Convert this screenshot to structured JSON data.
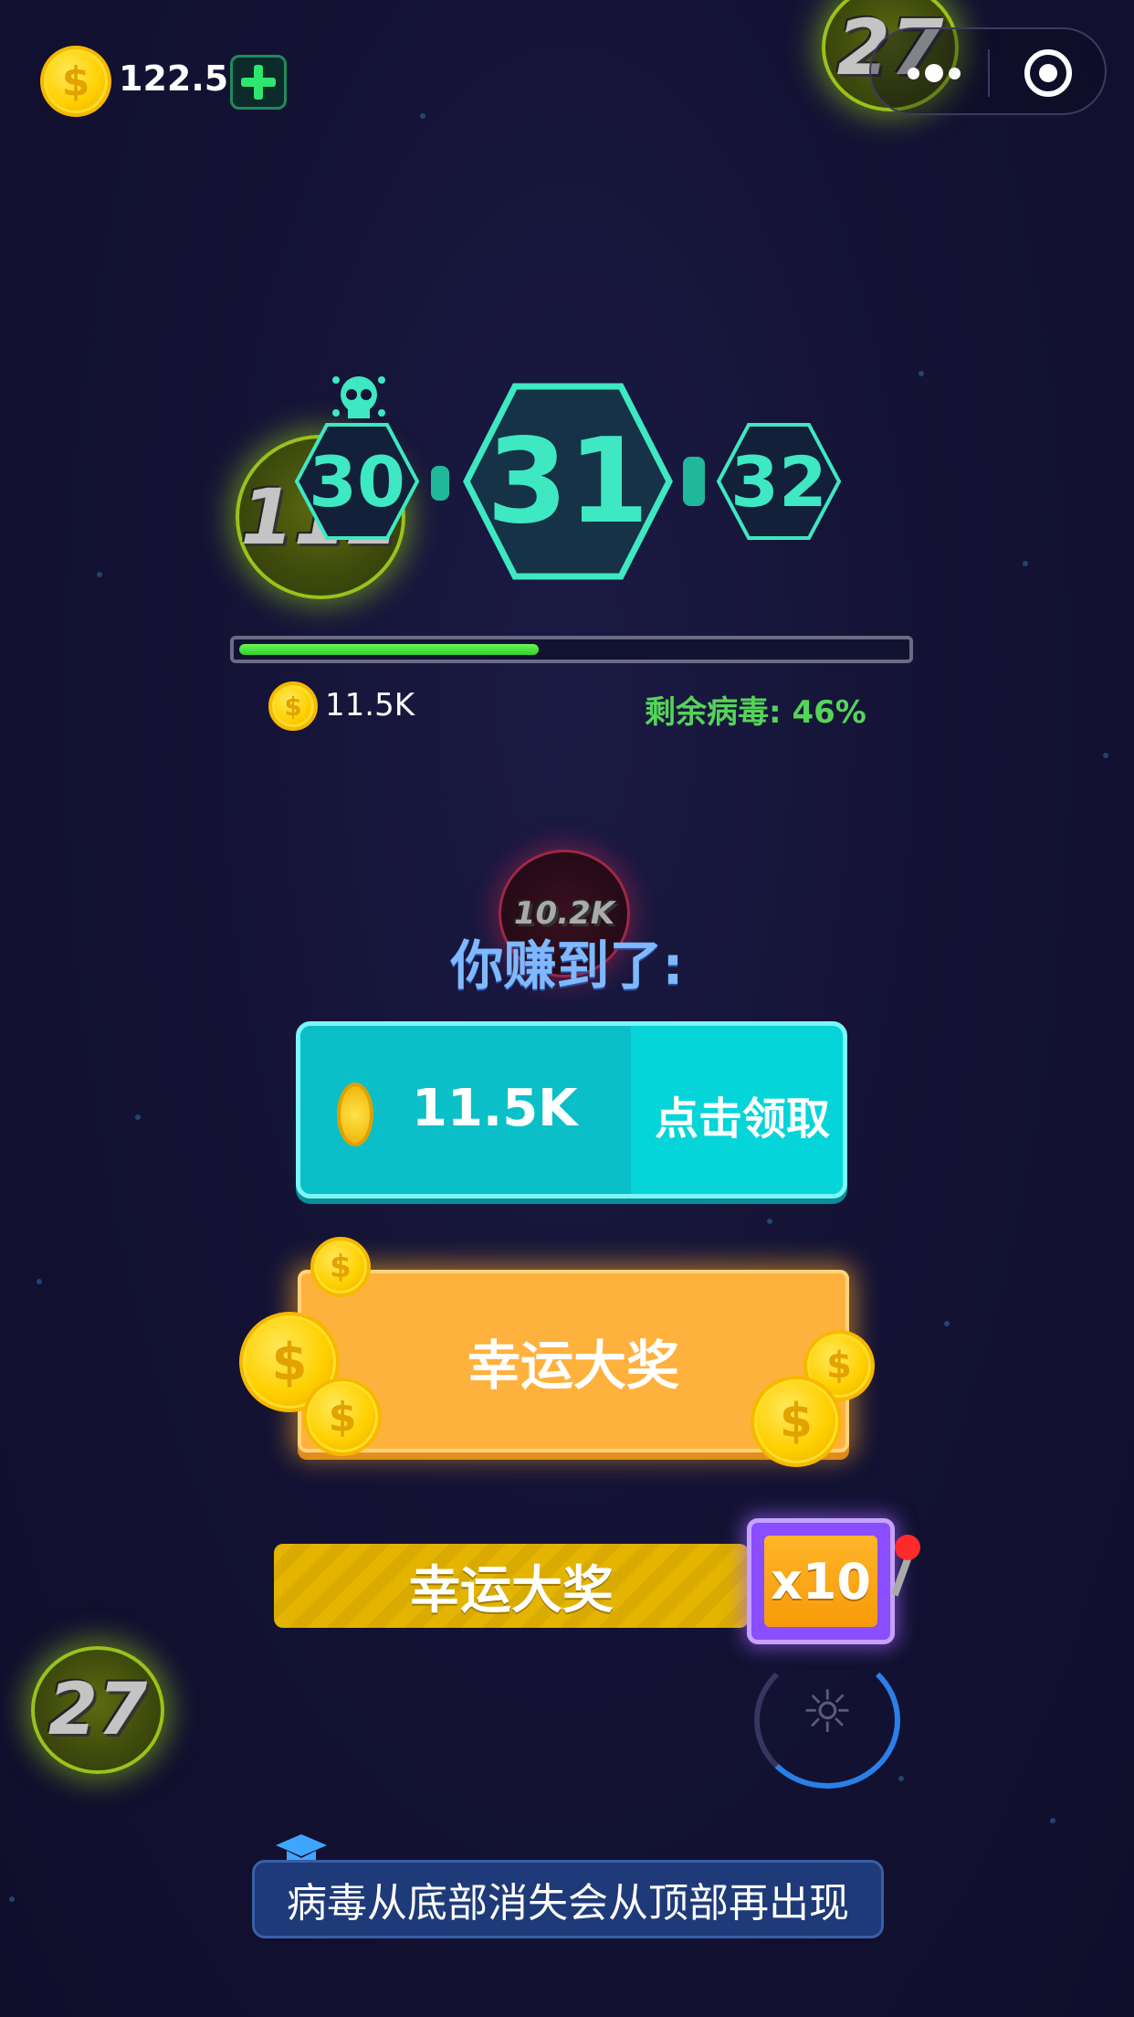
{
  "top_bar": {
    "coin_balance": "122.5K",
    "coin_symbol": "$"
  },
  "level": {
    "previous": "30",
    "current": "31",
    "next": "32"
  },
  "progress": {
    "fraction": 0.45
  },
  "stats": {
    "earned": "11.5K",
    "remaining_label": "剩余病毒",
    "remaining_value": "46%"
  },
  "background_viruses": [
    {
      "label": "27"
    },
    {
      "label": "112"
    },
    {
      "label": "27"
    },
    {
      "label": "10.2K"
    }
  ],
  "reward": {
    "title": "你赚到了:",
    "amount": "11.5K",
    "claim_label": "点击领取"
  },
  "lucky_button": {
    "label": "幸运大奖"
  },
  "lucky_bar": {
    "label": "幸运大奖",
    "multiplier": "x10"
  },
  "tip": {
    "text": "病毒从底部消失会从顶部再出现"
  },
  "colors": {
    "accent_teal": "#3ee8c2",
    "progress_green": "#2fd12a",
    "claim_cyan": "#12cfd6",
    "lucky_orange": "#ffb13e",
    "slot_purple": "#8a4dff"
  },
  "icons": {
    "coin": "coin-icon",
    "plus": "plus-icon",
    "more": "more-dots-icon",
    "close": "target-circle-icon",
    "skull": "skull-icon",
    "graduation": "graduation-cap-icon"
  }
}
